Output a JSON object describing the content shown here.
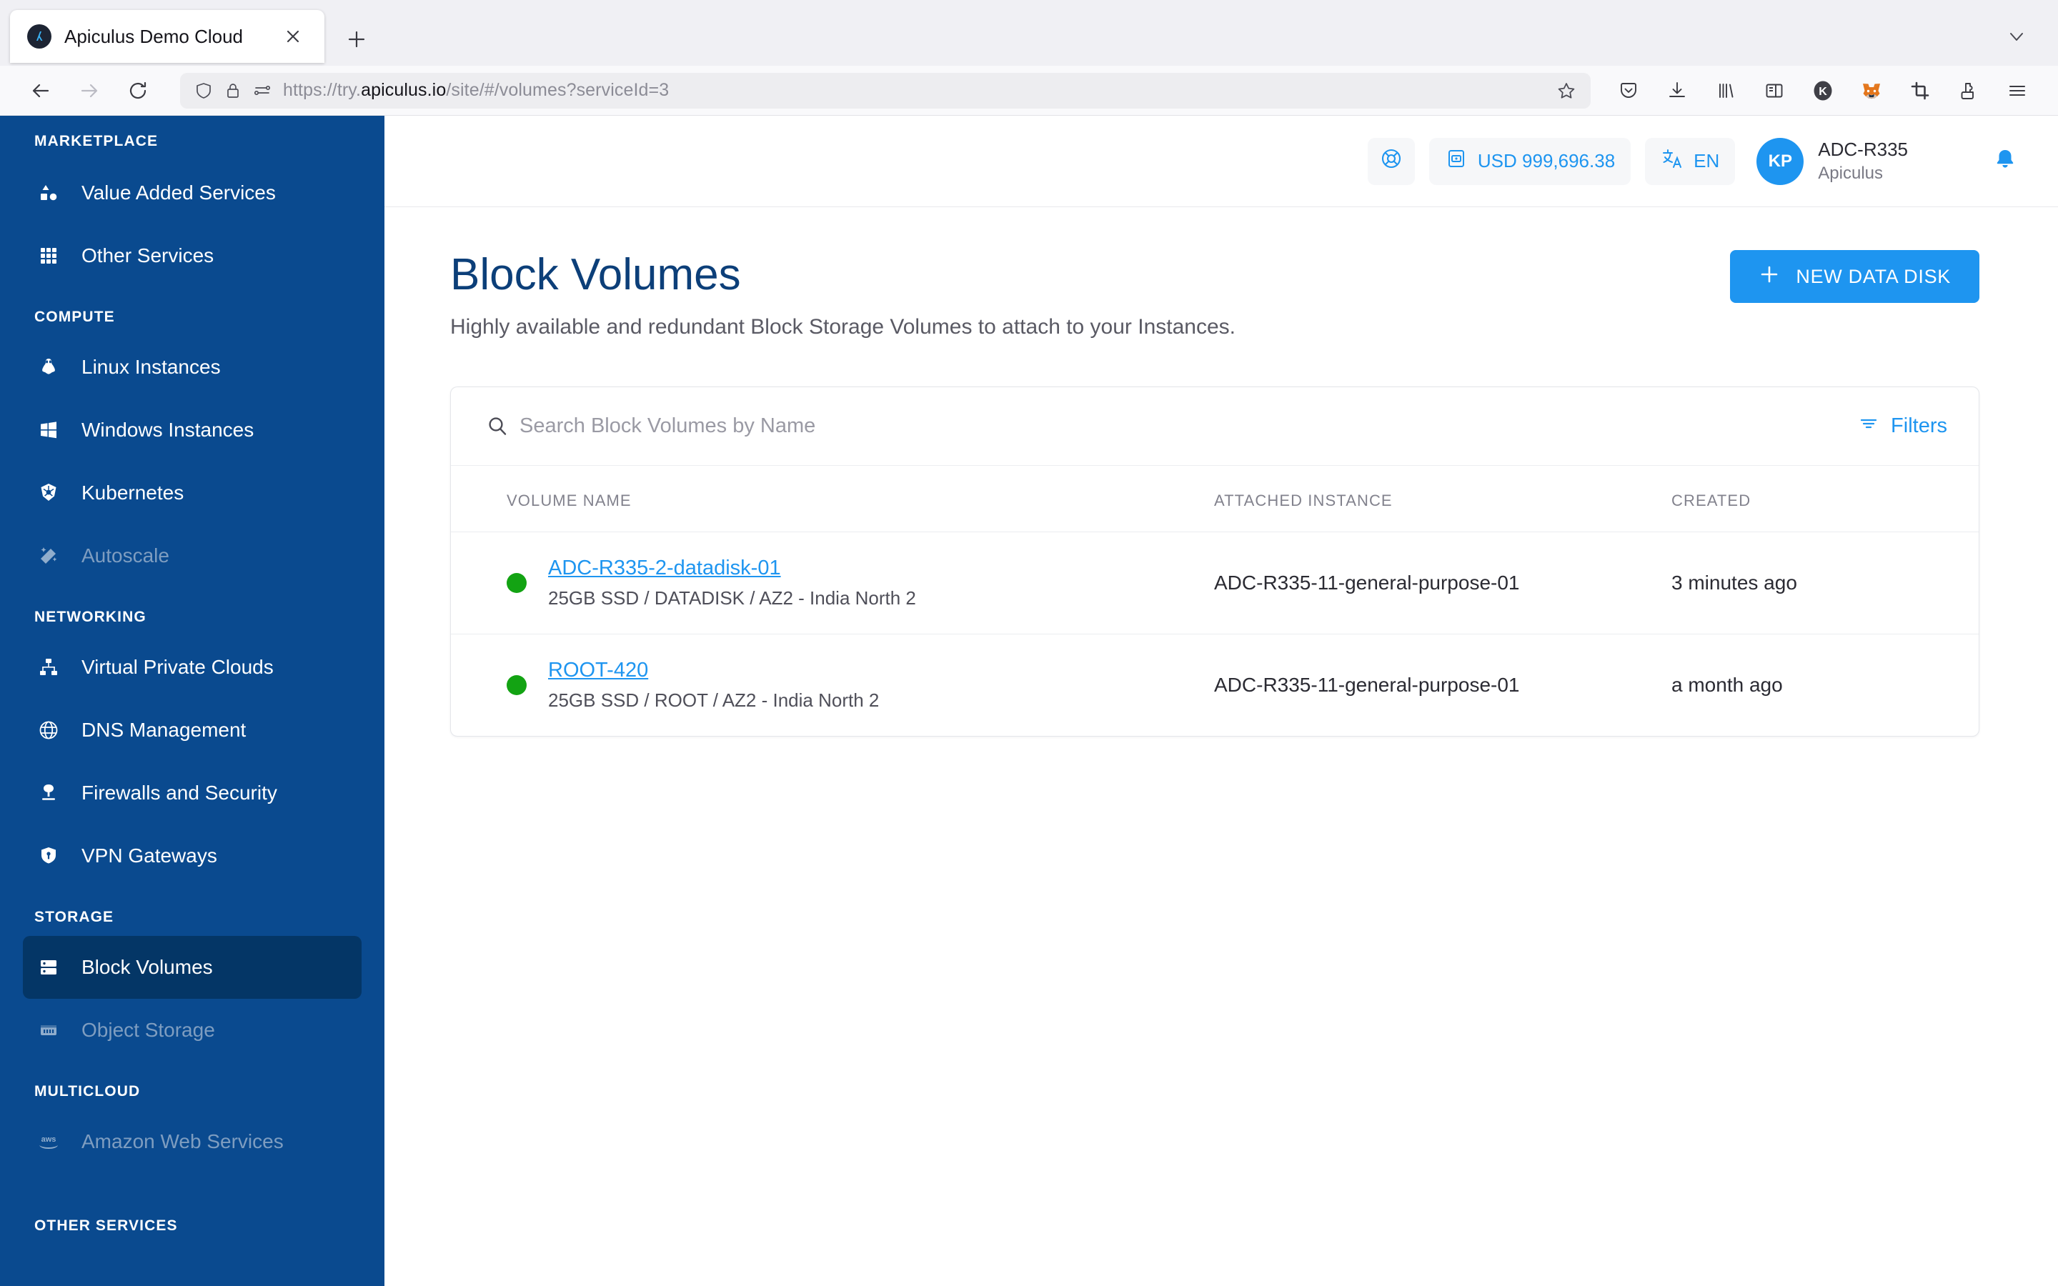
{
  "browser": {
    "tab": {
      "title": "Apiculus Demo Cloud",
      "favicon": "apiculus-logo-icon",
      "close": "close-icon"
    },
    "new_tab_label": "+",
    "tabstrip_list_icon": "chevron-down-icon",
    "nav": {
      "back": "back-arrow-icon",
      "forward": "forward-arrow-icon",
      "reload": "reload-icon"
    },
    "url": {
      "scheme": "https://try.",
      "host": "apiculus.io",
      "path": "/site/#/volumes?serviceId=3",
      "full": "https://try.apiculus.io/site/#/volumes?serviceId=3"
    },
    "url_icons": [
      "shield-icon",
      "lock-icon",
      "permissions-icon"
    ],
    "bookmark_icon": "star-icon",
    "toolbar_icons": [
      "pocket-save-icon",
      "downloads-icon",
      "library-icon",
      "sidebar-icon",
      "k-extension-icon",
      "metamask-fox-icon",
      "clipper-extension-icon",
      "extensions-puzzle-icon",
      "app-menu-icon"
    ],
    "k_extension_label": "K"
  },
  "sidebar": {
    "sections": [
      {
        "title": "MARKETPLACE",
        "items": [
          {
            "label": "Value Added Services",
            "icon": "shapes-icon",
            "state": "normal"
          },
          {
            "label": "Other Services",
            "icon": "grid-icon",
            "state": "normal"
          }
        ]
      },
      {
        "title": "COMPUTE",
        "items": [
          {
            "label": "Linux Instances",
            "icon": "linux-penguin-icon",
            "state": "normal"
          },
          {
            "label": "Windows Instances",
            "icon": "windows-icon",
            "state": "normal"
          },
          {
            "label": "Kubernetes",
            "icon": "kubernetes-icon",
            "state": "normal"
          },
          {
            "label": "Autoscale",
            "icon": "magic-wand-icon",
            "state": "disabled"
          }
        ]
      },
      {
        "title": "NETWORKING",
        "items": [
          {
            "label": "Virtual Private Clouds",
            "icon": "network-topology-icon",
            "state": "normal"
          },
          {
            "label": "DNS Management",
            "icon": "globe-icon",
            "state": "normal"
          },
          {
            "label": "Firewalls and Security",
            "icon": "firewall-icon",
            "state": "normal"
          },
          {
            "label": "VPN Gateways",
            "icon": "shield-key-icon",
            "state": "normal"
          }
        ]
      },
      {
        "title": "STORAGE",
        "items": [
          {
            "label": "Block Volumes",
            "icon": "server-disk-icon",
            "state": "active"
          },
          {
            "label": "Object Storage",
            "icon": "storage-box-icon",
            "state": "disabled"
          }
        ]
      },
      {
        "title": "MULTICLOUD",
        "items": [
          {
            "label": "Amazon Web Services",
            "icon": "aws-icon",
            "state": "disabled"
          }
        ]
      },
      {
        "title": "OTHER SERVICES",
        "items": []
      }
    ]
  },
  "appheader": {
    "support_icon": "lifebuoy-icon",
    "wallet": {
      "icon": "wallet-icon",
      "value": "USD 999,696.38"
    },
    "language": {
      "icon": "translate-icon",
      "value": "EN"
    },
    "user": {
      "initials": "KP",
      "name": "ADC-R335",
      "org": "Apiculus"
    },
    "notifications_icon": "bell-icon"
  },
  "main": {
    "title": "Block Volumes",
    "subtitle": "Highly available and redundant Block Storage Volumes to attach to your Instances.",
    "new_button": {
      "label": "NEW DATA DISK",
      "icon": "plus-icon"
    },
    "search": {
      "icon": "search-icon",
      "placeholder": "Search Block Volumes by Name",
      "value": ""
    },
    "filters": {
      "label": "Filters",
      "icon": "filter-icon"
    },
    "table": {
      "columns": [
        "VOLUME NAME",
        "ATTACHED INSTANCE",
        "CREATED"
      ],
      "rows": [
        {
          "status": "running",
          "name": "ADC-R335-2-datadisk-01",
          "meta": "25GB SSD / DATADISK / AZ2 - India North 2",
          "instance": "ADC-R335-11-general-purpose-01",
          "created": "3 minutes ago"
        },
        {
          "status": "running",
          "name": "ROOT-420",
          "meta": "25GB SSD / ROOT / AZ2 - India North 2",
          "instance": "ADC-R335-11-general-purpose-01",
          "created": "a month ago"
        }
      ]
    }
  },
  "colors": {
    "sidebar_bg": "#0a4a8f",
    "sidebar_active_bg": "#043666",
    "accent_blue": "#1e95f0",
    "title_navy": "#0c3f79",
    "status_green": "#13a313"
  }
}
